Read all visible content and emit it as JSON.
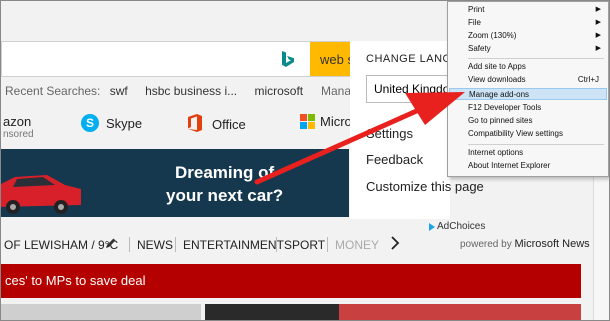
{
  "search": {
    "web_button_label": "web s",
    "recent_label": "Recent Searches:",
    "recent_items": [
      "swf",
      "hsbc business i...",
      "microsoft"
    ],
    "manage_label": "Mana"
  },
  "tiles": [
    {
      "label": "azon",
      "sub": "nsored"
    },
    {
      "label": "Skype"
    },
    {
      "label": "Office"
    },
    {
      "label": "Micro"
    }
  ],
  "banner": {
    "line1": "Dreaming of",
    "line2": "your next car?"
  },
  "panel": {
    "title": "CHANGE LANGU",
    "language": "United Kingdom",
    "links": [
      "Settings",
      "Feedback",
      "Customize this page"
    ]
  },
  "adchoices": "AdChoices",
  "newsnav": {
    "location": "OF LEWISHAM / 9°C",
    "items": [
      "NEWS",
      "ENTERTAINMENT",
      "SPORT",
      "MONEY"
    ],
    "powered_by": "powered by",
    "powered_brand": "Microsoft News"
  },
  "headline": "ces' to MPs to save deal",
  "menu": {
    "items": [
      {
        "label": "Print",
        "submenu": true
      },
      {
        "label": "File",
        "submenu": true
      },
      {
        "label": "Zoom (130%)",
        "submenu": true
      },
      {
        "label": "Safety",
        "submenu": true
      },
      {
        "label": "Add site to Apps"
      },
      {
        "label": "View downloads",
        "shortcut": "Ctrl+J"
      },
      {
        "label": "Manage add-ons",
        "highlighted": true
      },
      {
        "label": "F12 Developer Tools"
      },
      {
        "label": "Go to pinned sites"
      },
      {
        "label": "Compatibility View settings"
      },
      {
        "label": "Internet options"
      },
      {
        "label": "About Internet Explorer"
      }
    ]
  },
  "colors": {
    "accent_yellow": "#ffb900",
    "banner_blue": "#16384f",
    "headline_red": "#b50000",
    "arrow_red": "#e8201e",
    "menu_highlight": "#cde4f7"
  },
  "icons": [
    "bing-logo-icon",
    "skype-icon",
    "office-icon",
    "microsoft-logo-icon",
    "pencil-icon",
    "chevron-right-icon",
    "adchoices-icon",
    "submenu-arrow-icon"
  ]
}
